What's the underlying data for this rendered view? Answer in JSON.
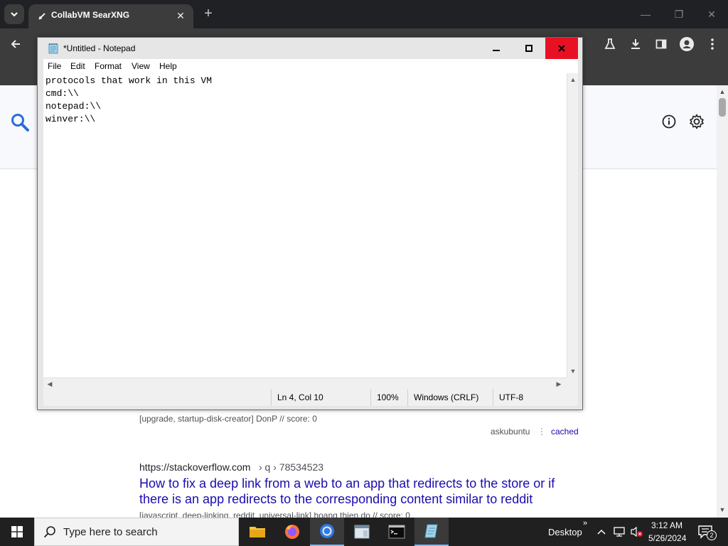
{
  "browser": {
    "tab_title": "CollabVM SearXNG",
    "tab_close": "✕",
    "new_tab": "+",
    "window_controls": {
      "minimize": "—",
      "restore": "❐",
      "close": "✕"
    }
  },
  "notepad": {
    "title": "*Untitled - Notepad",
    "menu": [
      "File",
      "Edit",
      "Format",
      "View",
      "Help"
    ],
    "content": "protocols that work in this VM\ncmd:\\\\\nnotepad:\\\\\nwinver:\\\\",
    "status": {
      "position": "Ln 4, Col 10",
      "zoom": "100%",
      "line_ending": "Windows (CRLF)",
      "encoding": "UTF-8"
    }
  },
  "results": [
    {
      "meta": "[upgrade, startup-disk-creator] DonP // score: 0",
      "engine": "askubuntu",
      "cached": "cached"
    },
    {
      "url": "https://stackoverflow.com",
      "path": "› q › 78534523",
      "title_line1": "How to fix a deep link from a web to an app that redirects to the store or if",
      "title_line2": "there is an app redirects to the corresponding content similar to reddit",
      "meta": "[javascript, deep-linking, reddit, universal-link] hoang thien do // score: 0"
    }
  ],
  "taskbar": {
    "search_placeholder": "Type here to search",
    "desktop_label": "Desktop",
    "time": "3:12 AM",
    "date": "5/26/2024",
    "notification_count": "2"
  }
}
